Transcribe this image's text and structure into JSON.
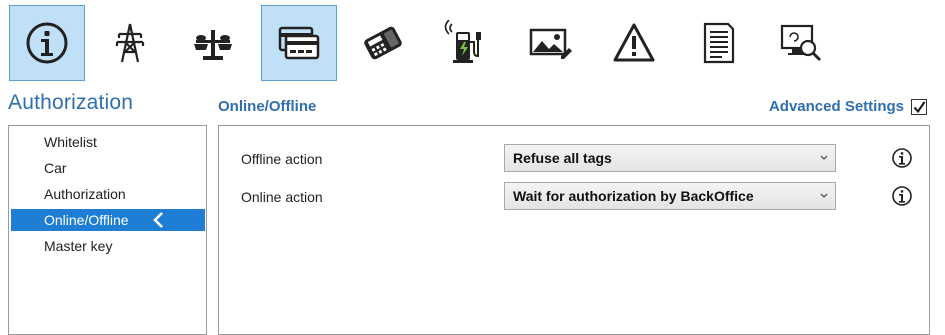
{
  "toolbar": {
    "items": [
      {
        "icon": "info-icon",
        "active": true
      },
      {
        "icon": "power-pylon-icon",
        "active": false
      },
      {
        "icon": "scale-balance-icon",
        "active": false
      },
      {
        "icon": "payment-card-icon",
        "active": true
      },
      {
        "icon": "card-terminal-icon",
        "active": false
      },
      {
        "icon": "ev-charger-icon",
        "active": false
      },
      {
        "icon": "picture-edit-icon",
        "active": false
      },
      {
        "icon": "warning-icon",
        "active": false
      },
      {
        "icon": "document-icon",
        "active": false
      },
      {
        "icon": "monitor-search-icon",
        "active": false
      }
    ]
  },
  "sidebar": {
    "title": "Authorization",
    "items": [
      {
        "label": "Whitelist"
      },
      {
        "label": "Car"
      },
      {
        "label": "Authorization"
      },
      {
        "label": "Online/Offline"
      },
      {
        "label": "Master key"
      }
    ],
    "selected": "Online/Offline"
  },
  "main": {
    "title": "Online/Offline",
    "advanced_settings": {
      "label": "Advanced Settings",
      "checked": true
    },
    "fields": [
      {
        "label": "Offline action",
        "value": "Refuse all tags"
      },
      {
        "label": "Online action",
        "value": "Wait for authorization by BackOffice"
      }
    ]
  },
  "colors": {
    "accent": "#2f6fad",
    "selection": "#1e7ed4",
    "toolbar_active_bg": "#bfe0f7",
    "toolbar_active_border": "#5aa0d6"
  }
}
